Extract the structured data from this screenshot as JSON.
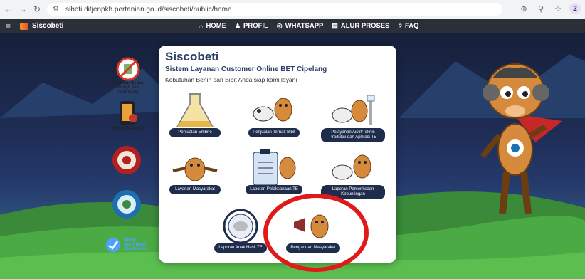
{
  "browser": {
    "url": "sibeti.ditjenpkh.pertanian.go.id/siscobeti/public/home",
    "profile_initial": "2"
  },
  "appbar": {
    "brand": "Siscobeti",
    "menu": [
      {
        "label": "HOME",
        "icon": "home-icon"
      },
      {
        "label": "PROFIL",
        "icon": "user-icon"
      },
      {
        "label": "WHATSAPP",
        "icon": "whatsapp-icon"
      },
      {
        "label": "ALUR PROSES",
        "icon": "document-icon"
      },
      {
        "label": "FAQ",
        "icon": "question-icon"
      }
    ]
  },
  "side_links": [
    {
      "label": "Layanan Bebas Pungli dan Gratifikasi",
      "icon": "no-bribery-icon"
    },
    {
      "label": "Informasi Publik",
      "icon": "public-info-icon"
    },
    {
      "label": "",
      "icon": "zona-integritas-badge-icon"
    },
    {
      "label": "",
      "icon": "wbk-badge-icon"
    }
  ],
  "bse": {
    "line1": "Balai",
    "line2": "Sertifikasi",
    "line3": "Elektronik"
  },
  "card": {
    "title": "Siscobeti",
    "subtitle": "Sistem Layanan Customer Online BET Cipelang",
    "description": "Kebutuhan Benih dan Bibit Anda siap kami layani",
    "tiles": [
      {
        "label": "Penjualan Embrio"
      },
      {
        "label": "Penjualan Ternak Bibit"
      },
      {
        "label": "Pelayanan Aistif/Teknis Produksi dan Aplikasi TE"
      },
      {
        "label": "Layanan Masyarakat"
      },
      {
        "label": "Laporan Pelaksanaan TE"
      },
      {
        "label": "Laporan Pemeriksaan Kebuntingan"
      },
      {
        "label": "Laporan Anak Hasil TE"
      },
      {
        "label": "Pengaduan Masyarakat"
      }
    ]
  },
  "colors": {
    "annotation": "#e01a1a",
    "navbar": "#2b2f3a",
    "button": "#1f2d4d"
  }
}
